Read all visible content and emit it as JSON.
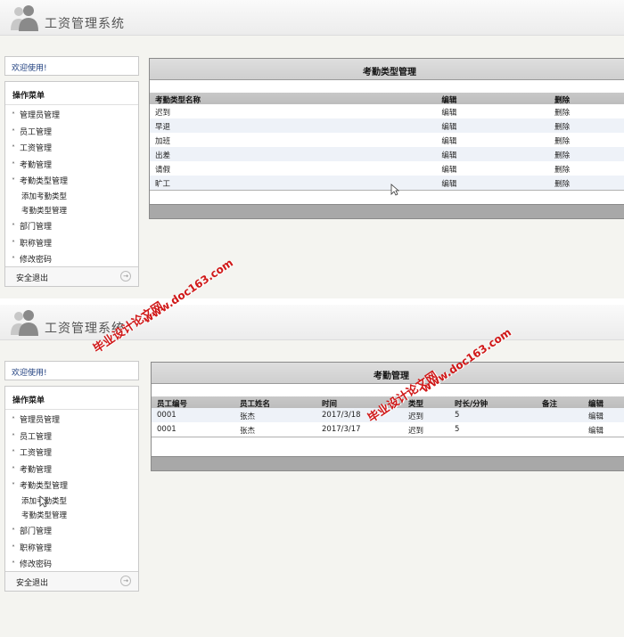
{
  "app": {
    "title": "工资管理系统"
  },
  "sidebar": {
    "welcome": "欢迎使用!",
    "menu_title": "操作菜单",
    "items": [
      {
        "label": "管理员管理"
      },
      {
        "label": "员工管理"
      },
      {
        "label": "工资管理"
      },
      {
        "label": "考勤管理"
      },
      {
        "label": "考勤类型管理",
        "children": [
          "添加考勤类型",
          "考勤类型管理"
        ]
      },
      {
        "label": "部门管理"
      },
      {
        "label": "职称管理"
      },
      {
        "label": "修改密码"
      }
    ],
    "logout": "安全退出"
  },
  "screen1": {
    "panel_title": "考勤类型管理",
    "columns": [
      "考勤类型名称",
      "编辑",
      "删除"
    ],
    "rows": [
      [
        "迟到",
        "编辑",
        "删除"
      ],
      [
        "早退",
        "编辑",
        "删除"
      ],
      [
        "加班",
        "编辑",
        "删除"
      ],
      [
        "出差",
        "编辑",
        "删除"
      ],
      [
        "请假",
        "编辑",
        "删除"
      ],
      [
        "旷工",
        "编辑",
        "删除"
      ]
    ]
  },
  "screen2": {
    "panel_title": "考勤管理",
    "columns": [
      "员工编号",
      "员工姓名",
      "时间",
      "类型",
      "时长/分钟",
      "备注",
      "编辑"
    ],
    "rows": [
      [
        "0001",
        "张杰",
        "2017/3/18",
        "迟到",
        "5",
        "",
        "编辑"
      ],
      [
        "0001",
        "张杰",
        "2017/3/17",
        "迟到",
        "5",
        "",
        "编辑"
      ]
    ]
  },
  "watermark": {
    "line1": "毕业设计论文网",
    "line2": "www.doc163.com"
  },
  "colors": {
    "watermark": "#d01818",
    "link": "#1f3f7f"
  }
}
